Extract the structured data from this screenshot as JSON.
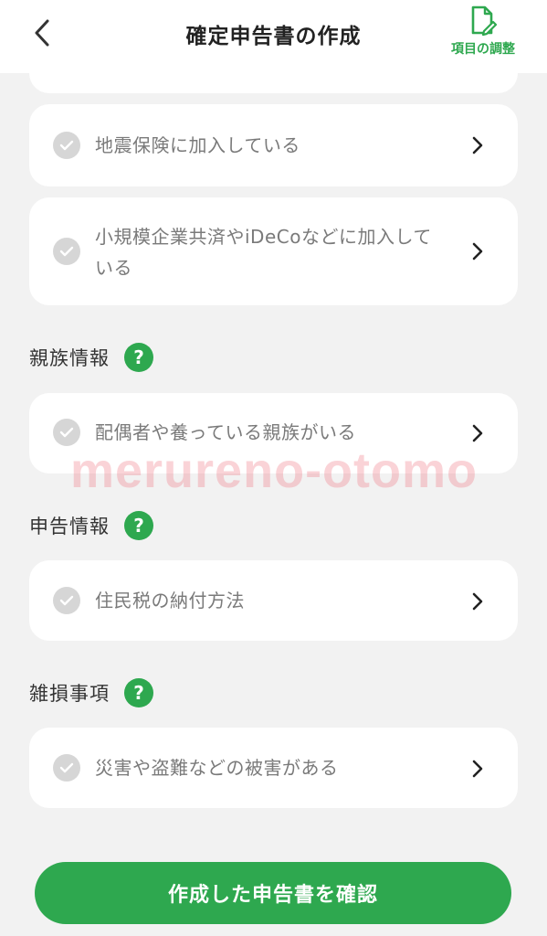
{
  "header": {
    "title": "確定申告書の作成",
    "adjust_label": "項目の調整"
  },
  "cards": {
    "earthquake": "地震保険に加入している",
    "ideco": "小規模企業共済やiDeCoなどに加入している",
    "dependents": "配偶者や養っている親族がいる",
    "resident_tax": "住民税の納付方法",
    "disaster": "災害や盗難などの被害がある"
  },
  "sections": {
    "family": "親族情報",
    "filing": "申告情報",
    "casualty": "雑損事項",
    "help_glyph": "?"
  },
  "watermark": "merureno-otomo",
  "footer": {
    "confirm_label": "作成した申告書を確認"
  },
  "colors": {
    "accent": "#2ea84f",
    "background": "#f2f2f2",
    "card": "#ffffff",
    "check_inactive": "#d6d6d6"
  }
}
